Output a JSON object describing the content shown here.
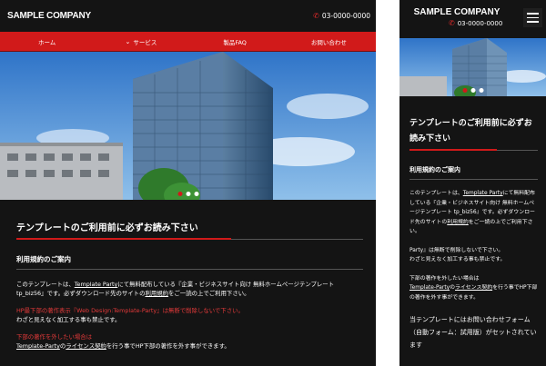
{
  "desktop": {
    "header": {
      "logo": "SAMPLE COMPANY",
      "phone": "03-0000-0000"
    },
    "nav": [
      {
        "label": "ホーム"
      },
      {
        "label": "サービス"
      },
      {
        "label": "製品FAQ"
      },
      {
        "label": "お問い合わせ"
      }
    ],
    "content": {
      "title": "テンプレートのご利用前に必ずお読み下さい",
      "subtitle": "利用規約のご案内",
      "p1_a": "このテンプレートは、",
      "p1_link": "Template Party",
      "p1_b": "にて無料配布している『企業・ビジネスサイト向け 無料ホームページテンプレート tp_biz56』です。必ずダウンロード先のサイトの",
      "p1_link2": "利用規約",
      "p1_c": "をご一読の上でご利用下さい。",
      "red1": "HP最下部の著作表示『Web Design:Template-Party』は無断で削除しないで下さい。",
      "p2": "わざと見えなく加工する事も禁止です。",
      "red2": "下部の著作を外したい場合は",
      "p3_link": "Template-Party",
      "p3_a": "の",
      "p3_link2": "ライセンス契約",
      "p3_b": "を行う事でHP下部の著作を外す事ができます。"
    }
  },
  "mobile": {
    "header": {
      "logo": "SAMPLE COMPANY",
      "phone": "03-0000-0000"
    },
    "content": {
      "title": "テンプレートのご利用前に必ずお読み下さい",
      "subtitle": "利用規約のご案内",
      "p1_a": "このテンプレートは、",
      "p1_link": "Template Party",
      "p1_b": "にて無料配布している『企業・ビジネスサイト向け 無料ホームページテンプレート tp_biz56』です。必ずダウンロード先のサイトの",
      "p1_link2": "利用規約",
      "p1_c": "をご一読の上でご利用下さい。",
      "red1": "Party』は無断で削除しないで下さい。",
      "p2": "わざと見えなく加工する事も禁止です。",
      "red2": "下部の著作を外したい場合は",
      "p3_link": "Template-Party",
      "p3_a": "の",
      "p3_link2": "ライセンス契約",
      "p3_b": "を行う事でHP下部の著作を外す事ができます。",
      "section2": "当テンプレートにはお問い合わせフォーム（自動フォーム：試用版）がセットされています"
    }
  },
  "colors": {
    "accent": "#d11a1a",
    "background": "#141414",
    "text": "#ffffff",
    "alert": "#e53a3a"
  },
  "icons": {
    "phone": "phone-icon",
    "menu": "hamburger-menu-icon",
    "dropdown": "chevron-down-icon"
  }
}
